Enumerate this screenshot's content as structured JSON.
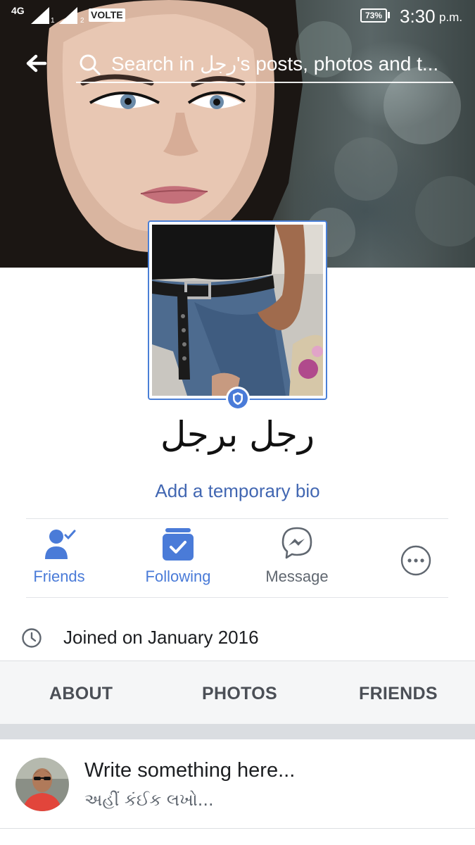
{
  "status_bar": {
    "network": "4G",
    "sim1": "1",
    "sim2": "2",
    "volte": "VOLTE",
    "battery": "73%",
    "time": "3:30",
    "ampm": "p.m."
  },
  "header": {
    "back_icon": "arrow-left-icon",
    "search_icon": "search-icon",
    "search_placeholder": "Search in رجل's posts, photos and t..."
  },
  "profile": {
    "name": "رجل برجل",
    "bio_link": "Add a temporary bio",
    "badge_icon": "profile-guard-shield-icon"
  },
  "actions": [
    {
      "label": "Friends",
      "icon": "friends-check-icon",
      "active": true
    },
    {
      "label": "Following",
      "icon": "following-feed-icon",
      "active": true
    },
    {
      "label": "Message",
      "icon": "messenger-icon",
      "active": false
    },
    {
      "label": "",
      "icon": "more-options-icon",
      "active": false
    }
  ],
  "info": {
    "icon": "clock-icon",
    "joined": "Joined on January 2016"
  },
  "tabs": [
    "ABOUT",
    "PHOTOS",
    "FRIENDS"
  ],
  "composer": {
    "prompt": "Write something here...",
    "prompt_secondary": "અહીં કંઈક લખો..."
  },
  "colors": {
    "accent": "#4a7bd8",
    "link": "#4267b2",
    "tab_bg": "#f5f6f7",
    "separator": "#dadde1"
  }
}
